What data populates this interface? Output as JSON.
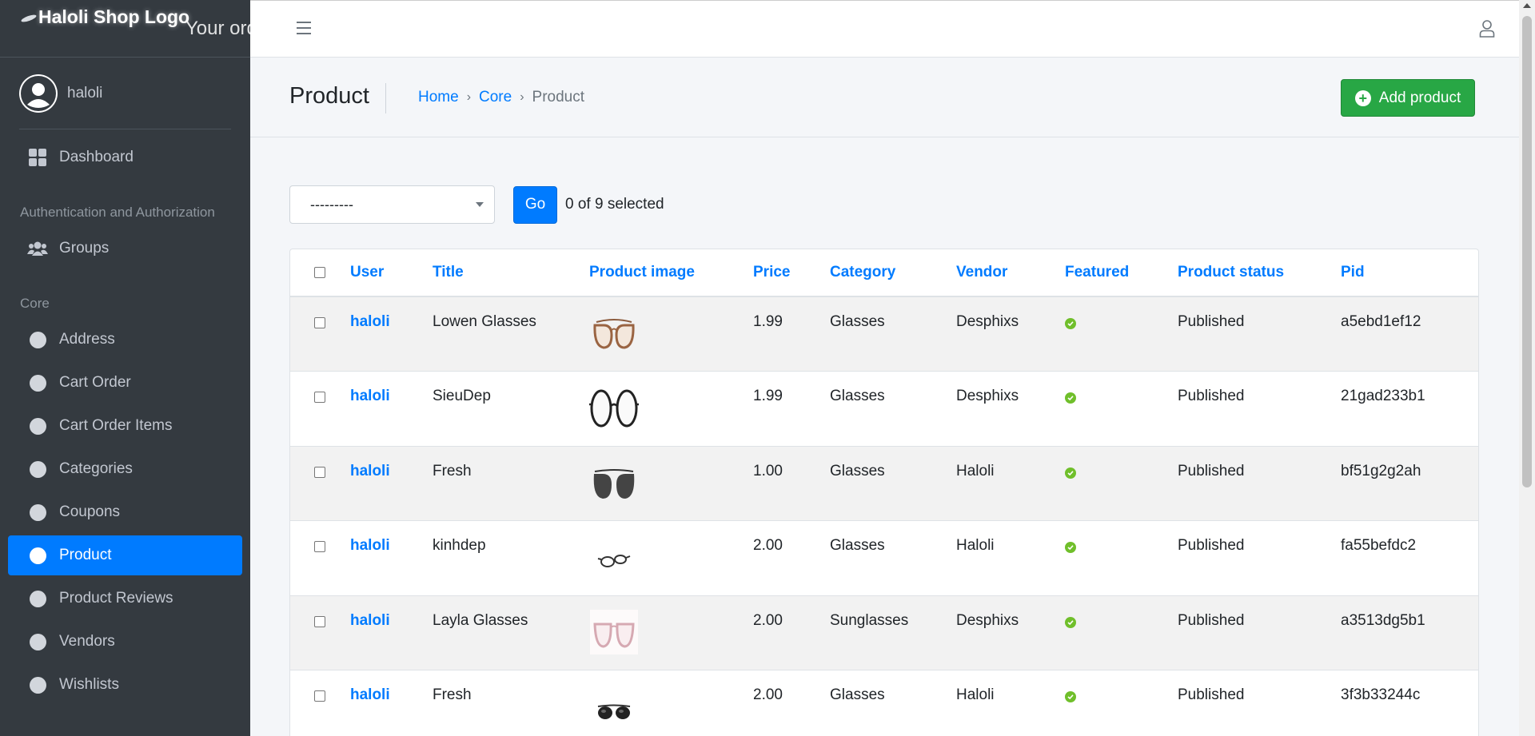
{
  "brand": {
    "logo_text": "Haloli Shop Logo",
    "tagline": "Your ord"
  },
  "user": {
    "name": "haloli"
  },
  "sidebar": {
    "dashboard": "Dashboard",
    "auth_header": "Authentication and Authorization",
    "groups": "Groups",
    "core_header": "Core",
    "items": [
      "Address",
      "Cart Order",
      "Cart Order Items",
      "Categories",
      "Coupons",
      "Product",
      "Product Reviews",
      "Vendors",
      "Wishlists"
    ],
    "active_item": "Product"
  },
  "header": {
    "title": "Product",
    "breadcrumb": [
      "Home",
      "Core",
      "Product"
    ],
    "breadcrumb_separator": "›",
    "add_button": "Add product"
  },
  "actions": {
    "select_value": "---------",
    "go_button": "Go",
    "selected_text": "0 of 9 selected"
  },
  "table": {
    "columns": [
      "User",
      "Title",
      "Product image",
      "Price",
      "Category",
      "Vendor",
      "Featured",
      "Product status",
      "Pid"
    ],
    "rows": [
      {
        "user": "haloli",
        "title": "Lowen Glasses",
        "image": "brown-aviator-glasses",
        "price": "1.99",
        "category": "Glasses",
        "vendor": "Desphixs",
        "featured": true,
        "status": "Published",
        "pid": "a5ebd1ef12"
      },
      {
        "user": "haloli",
        "title": "SieuDep",
        "image": "round-black-glasses",
        "price": "1.99",
        "category": "Glasses",
        "vendor": "Desphixs",
        "featured": true,
        "status": "Published",
        "pid": "21gad233b1"
      },
      {
        "user": "haloli",
        "title": "Fresh",
        "image": "dark-aviator-sunglasses",
        "price": "1.00",
        "category": "Glasses",
        "vendor": "Haloli",
        "featured": true,
        "status": "Published",
        "pid": "bf51g2g2ah"
      },
      {
        "user": "haloli",
        "title": "kinhdep",
        "image": "small-black-glasses",
        "price": "2.00",
        "category": "Glasses",
        "vendor": "Haloli",
        "featured": true,
        "status": "Published",
        "pid": "fa55befdc2"
      },
      {
        "user": "haloli",
        "title": "Layla Glasses",
        "image": "pink-clear-glasses",
        "price": "2.00",
        "category": "Sunglasses",
        "vendor": "Desphixs",
        "featured": true,
        "status": "Published",
        "pid": "a3513dg5b1"
      },
      {
        "user": "haloli",
        "title": "Fresh",
        "image": "black-sunglasses",
        "price": "2.00",
        "category": "Glasses",
        "vendor": "Haloli",
        "featured": true,
        "status": "Published",
        "pid": "3f3b33244c"
      }
    ]
  },
  "colors": {
    "sidebar_bg": "#343a40",
    "primary": "#007bff",
    "success": "#28a745",
    "featured_check": "#70bf2b"
  }
}
